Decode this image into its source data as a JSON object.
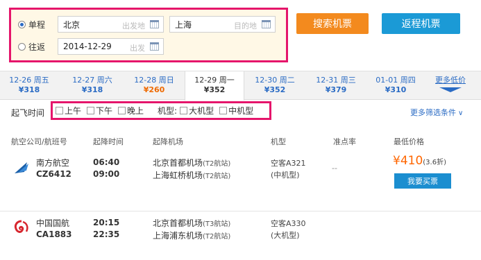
{
  "search": {
    "one_way_label": "单程",
    "round_trip_label": "往返",
    "departure_city": "北京",
    "departure_placeholder": "出发地",
    "arrival_city": "上海",
    "arrival_placeholder": "目的地",
    "depart_date": "2014-12-29",
    "depart_date_placeholder": "出发",
    "search_button": "搜索机票",
    "return_button": "返程机票",
    "selected_trip": "单程"
  },
  "date_tabs": [
    {
      "date": "12-26 周五",
      "price": "¥318"
    },
    {
      "date": "12-27 周六",
      "price": "¥318"
    },
    {
      "date": "12-28 周日",
      "price": "¥260"
    },
    {
      "date": "12-29 周一",
      "price": "¥352"
    },
    {
      "date": "12-30 周二",
      "price": "¥352"
    },
    {
      "date": "12-31 周三",
      "price": "¥379"
    },
    {
      "date": "01-01 周四",
      "price": "¥310"
    },
    {
      "date": "更多低价",
      "price": ""
    }
  ],
  "filters": {
    "label": "起飞时间",
    "morning": "上午",
    "afternoon": "下午",
    "evening": "晚上",
    "plane_label": "机型:",
    "large": "大机型",
    "medium": "中机型",
    "more": "更多筛选条件"
  },
  "table_headers": {
    "airline": "航空公司/航班号",
    "times": "起降时间",
    "airports": "起降机场",
    "plane": "机型",
    "ontime": "准点率",
    "price": "最低价格"
  },
  "flights": [
    {
      "airline": "南方航空",
      "flight_no": "CZ6412",
      "dep_time": "06:40",
      "arr_time": "09:00",
      "dep_airport": "北京首都机场",
      "dep_terminal": "(T2航站)",
      "arr_airport": "上海虹桥机场",
      "arr_terminal": "(T2航站)",
      "plane": "空客A321",
      "plane_size": "(中机型)",
      "ontime": "--",
      "price": "¥410",
      "discount": "(3.6折)",
      "book": "我要买票",
      "logo_color": "#1a5fa8"
    },
    {
      "airline": "中国国航",
      "flight_no": "CA1883",
      "dep_time": "20:15",
      "arr_time": "22:35",
      "dep_airport": "北京首都机场",
      "dep_terminal": "(T3航站)",
      "arr_airport": "上海浦东机场",
      "arr_terminal": "(T2航站)",
      "plane": "空客A330",
      "plane_size": "(大机型)",
      "logo_color": "#d7262e"
    }
  ],
  "colors": {
    "accent_orange": "#f38a1e",
    "accent_blue": "#1b9ad6",
    "highlight": "#e5156b",
    "price": "#ff6600"
  }
}
